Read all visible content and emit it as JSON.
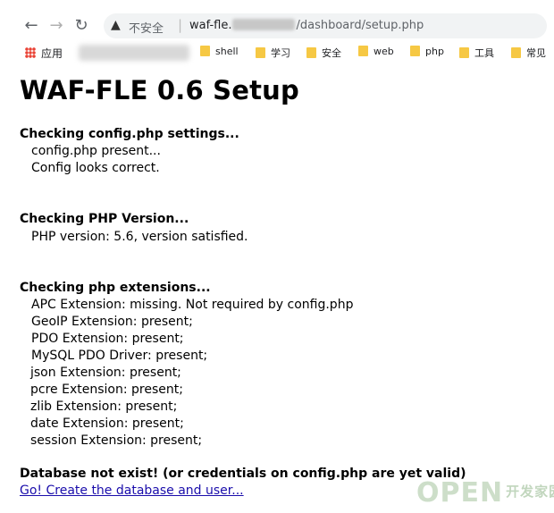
{
  "browser": {
    "url_prefix": "waf-fle.",
    "url_path": "/dashboard/setup.php",
    "insecure_label": "不安全",
    "separator": "|",
    "bookmarks_apps_label": "应用",
    "bookmarks": [
      "shell",
      "学习",
      "安全",
      "web",
      "php",
      "工具",
      "常见"
    ]
  },
  "page": {
    "title": "WAF-FLE 0.6 Setup",
    "sections": [
      {
        "heading": "Checking config.php settings...",
        "lines": [
          "config.php present...",
          "Config looks correct."
        ]
      },
      {
        "heading": "Checking PHP Version...",
        "lines": [
          "PHP version: 5.6, version satisfied."
        ]
      },
      {
        "heading": "Checking php extensions...",
        "lines": [
          "APC Extension: missing. Not required by config.php",
          "GeoIP Extension: present;",
          "PDO Extension: present;",
          "MySQL PDO Driver: present;",
          "json Extension: present;",
          "pcre Extension: present;",
          "zlib Extension: present;",
          "date Extension: present;",
          "session Extension: present;"
        ]
      }
    ],
    "db_status": "Database not exist! (or credentials on config.php are yet valid)",
    "create_link": "Go! Create the database and user..."
  },
  "watermark": {
    "text": "OPEN",
    "sub": "开发家园"
  }
}
